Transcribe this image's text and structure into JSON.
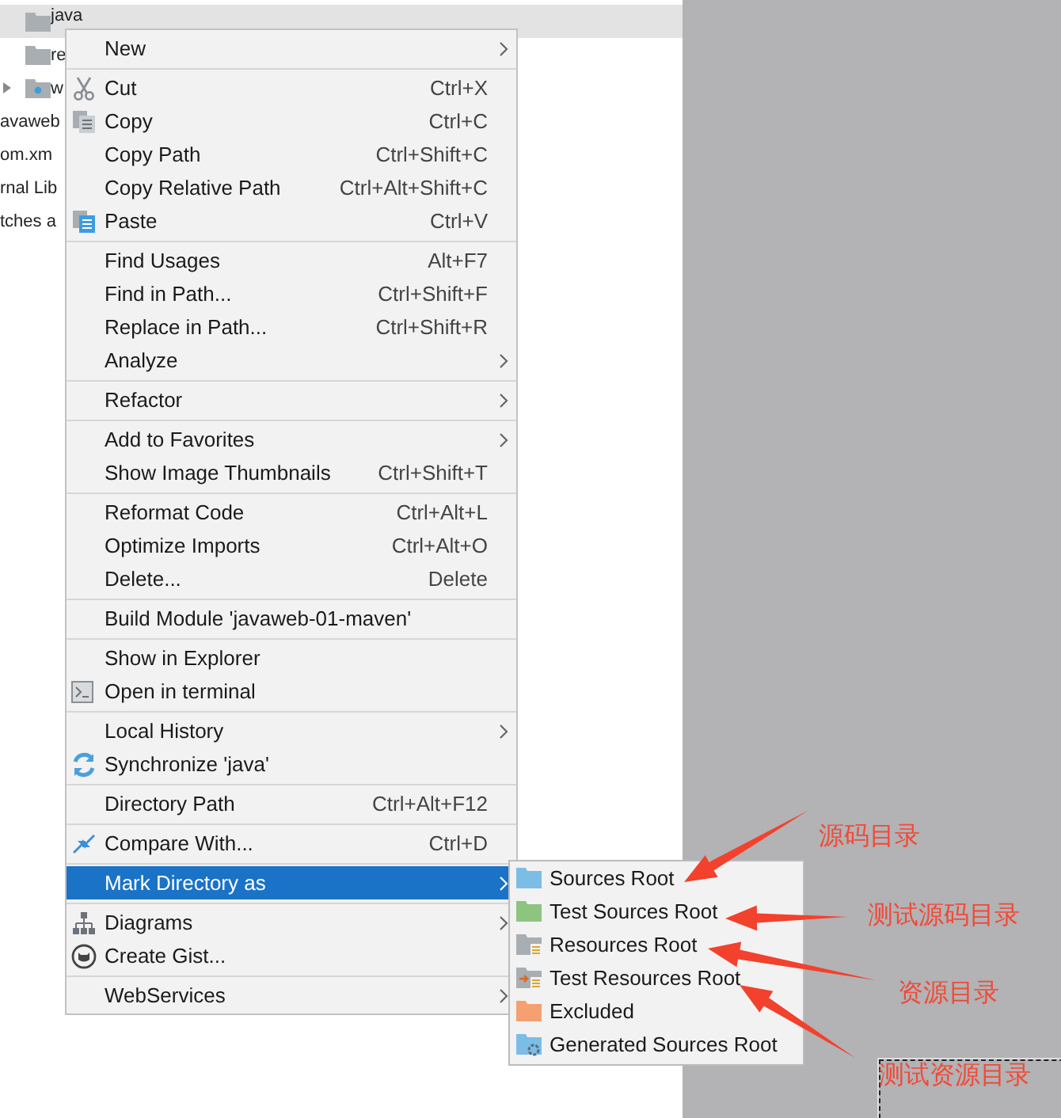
{
  "project_tree": {
    "rows": [
      {
        "label": "java",
        "selected": true,
        "kind": "folder",
        "arrow": false
      },
      {
        "label": "re",
        "selected": false,
        "kind": "folder",
        "arrow": false
      },
      {
        "label": "w",
        "selected": false,
        "kind": "web-folder",
        "arrow": true
      },
      {
        "label": "avaweb",
        "selected": false,
        "kind": "plain",
        "arrow": false
      },
      {
        "label": "om.xm",
        "selected": false,
        "kind": "plain",
        "arrow": false
      },
      {
        "label": "rnal Lib",
        "selected": false,
        "kind": "plain",
        "arrow": false
      },
      {
        "label": "tches a",
        "selected": false,
        "kind": "plain",
        "arrow": false
      }
    ]
  },
  "context_menu": {
    "groups": [
      {
        "items": [
          {
            "label": "New",
            "kind": "plain",
            "submenu": true,
            "selected": false
          }
        ]
      },
      {
        "items": [
          {
            "label": "Cut",
            "shortcut": "Ctrl+X",
            "kind": "scissors",
            "submenu": false,
            "selected": false
          },
          {
            "label": "Copy",
            "shortcut": "Ctrl+C",
            "kind": "copy",
            "submenu": false,
            "selected": false
          },
          {
            "label": "Copy Path",
            "shortcut": "Ctrl+Shift+C",
            "kind": "plain",
            "submenu": false,
            "selected": false
          },
          {
            "label": "Copy Relative Path",
            "shortcut": "Ctrl+Alt+Shift+C",
            "kind": "plain",
            "submenu": false,
            "selected": false
          },
          {
            "label": "Paste",
            "shortcut": "Ctrl+V",
            "kind": "paste",
            "submenu": false,
            "selected": false
          }
        ]
      },
      {
        "items": [
          {
            "label": "Find Usages",
            "shortcut": "Alt+F7",
            "kind": "plain",
            "submenu": false,
            "selected": false
          },
          {
            "label": "Find in Path...",
            "shortcut": "Ctrl+Shift+F",
            "kind": "plain",
            "submenu": false,
            "selected": false
          },
          {
            "label": "Replace in Path...",
            "shortcut": "Ctrl+Shift+R",
            "kind": "plain",
            "submenu": false,
            "selected": false
          },
          {
            "label": "Analyze",
            "kind": "plain",
            "submenu": true,
            "selected": false
          }
        ]
      },
      {
        "items": [
          {
            "label": "Refactor",
            "kind": "plain",
            "submenu": true,
            "selected": false
          }
        ]
      },
      {
        "items": [
          {
            "label": "Add to Favorites",
            "kind": "plain",
            "submenu": true,
            "selected": false
          },
          {
            "label": "Show Image Thumbnails",
            "shortcut": "Ctrl+Shift+T",
            "kind": "plain",
            "submenu": false,
            "selected": false
          }
        ]
      },
      {
        "items": [
          {
            "label": "Reformat Code",
            "shortcut": "Ctrl+Alt+L",
            "kind": "plain",
            "submenu": false,
            "selected": false
          },
          {
            "label": "Optimize Imports",
            "shortcut": "Ctrl+Alt+O",
            "kind": "plain",
            "submenu": false,
            "selected": false
          },
          {
            "label": "Delete...",
            "shortcut": "Delete",
            "kind": "plain",
            "submenu": false,
            "selected": false
          }
        ]
      },
      {
        "items": [
          {
            "label": "Build Module 'javaweb-01-maven'",
            "kind": "plain",
            "submenu": false,
            "selected": false
          }
        ]
      },
      {
        "items": [
          {
            "label": "Show in Explorer",
            "kind": "plain",
            "submenu": false,
            "selected": false
          },
          {
            "label": "Open in terminal",
            "kind": "terminal",
            "submenu": false,
            "selected": false
          }
        ]
      },
      {
        "items": [
          {
            "label": "Local History",
            "kind": "plain",
            "submenu": true,
            "selected": false
          },
          {
            "label": "Synchronize 'java'",
            "kind": "sync",
            "submenu": false,
            "selected": false
          }
        ]
      },
      {
        "items": [
          {
            "label": "Directory Path",
            "shortcut": "Ctrl+Alt+F12",
            "kind": "plain",
            "submenu": false,
            "selected": false
          }
        ]
      },
      {
        "items": [
          {
            "label": "Compare With...",
            "shortcut": "Ctrl+D",
            "kind": "compare",
            "submenu": false,
            "selected": false
          }
        ]
      },
      {
        "items": [
          {
            "label": "Mark Directory as",
            "kind": "plain",
            "submenu": true,
            "selected": true
          }
        ]
      },
      {
        "items": [
          {
            "label": "Diagrams",
            "kind": "diagram",
            "submenu": true,
            "selected": false
          },
          {
            "label": "Create Gist...",
            "kind": "gist",
            "submenu": false,
            "selected": false
          }
        ]
      },
      {
        "items": [
          {
            "label": "WebServices",
            "kind": "plain",
            "submenu": true,
            "selected": false
          }
        ]
      }
    ]
  },
  "submenu": {
    "items": [
      {
        "label": "Sources Root",
        "kind": "sources"
      },
      {
        "label": "Test Sources Root",
        "kind": "test-sources"
      },
      {
        "label": "Resources Root",
        "kind": "resources"
      },
      {
        "label": "Test Resources Root",
        "kind": "test-resources"
      },
      {
        "label": "Excluded",
        "kind": "excluded"
      },
      {
        "label": "Generated Sources Root",
        "kind": "generated"
      }
    ]
  },
  "annotations": [
    {
      "text": "源码目录"
    },
    {
      "text": "测试源码目录"
    },
    {
      "text": "资源目录"
    },
    {
      "text": "测试资源目录"
    }
  ]
}
